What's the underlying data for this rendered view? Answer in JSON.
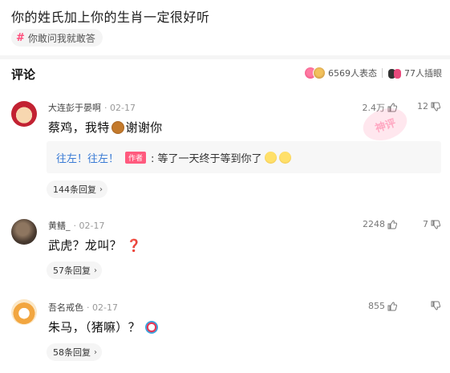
{
  "post": {
    "title": "你的姓氏加上你的生肖一定很好听",
    "topic": "你敢问我就敢答"
  },
  "comments_header": {
    "label": "评论",
    "reactions": "6569人表态",
    "watchers": "77人插眼"
  },
  "comments": [
    {
      "user": "大连彭于晏啊",
      "date": "· 02-17",
      "likes": "2.4万",
      "dislikes": "12",
      "text_before": "蔡鸡，我特",
      "text_after": "谢谢你",
      "reply": {
        "name": "往左！往左！",
        "tag": "作者",
        "text": ": 等了一天终于等到你了"
      },
      "reply_count": "144条回复"
    },
    {
      "user": "黄鳝_",
      "date": "· 02-17",
      "likes": "2248",
      "dislikes": "7",
      "text": "武虎？龙叫？",
      "mark": "❓",
      "reply_count": "57条回复"
    },
    {
      "user": "吾名戒色",
      "date": "· 02-17",
      "likes": "855",
      "dislikes": "",
      "text": "朱马，（猪嘛）？",
      "reply_count": "58条回复"
    }
  ],
  "icons": {
    "thumb_up": "thumb-up-icon",
    "thumb_down": "thumb-down-icon",
    "chevron": "›"
  },
  "colors": {
    "accent": "#ff4c7a",
    "link": "#3a7bd5"
  }
}
